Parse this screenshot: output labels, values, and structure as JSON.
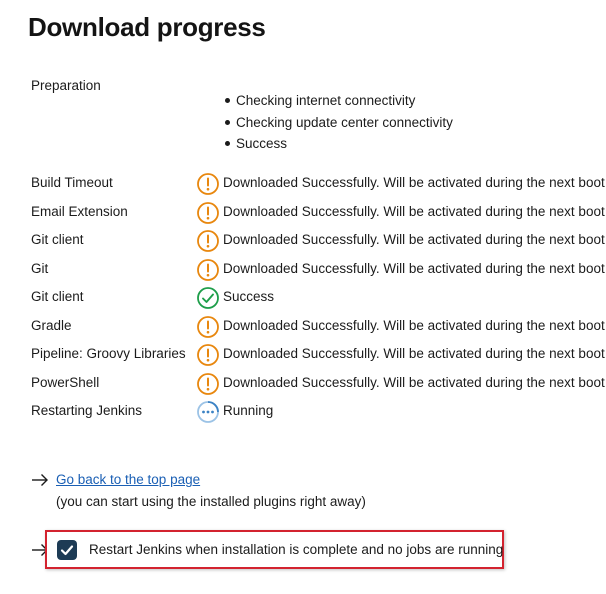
{
  "page": {
    "title": "Download progress"
  },
  "preparation": {
    "label": "Preparation",
    "steps": [
      "Checking internet connectivity",
      "Checking update center connectivity",
      "Success"
    ]
  },
  "plugins": [
    {
      "name": "Build Timeout",
      "status": "Downloaded Successfully. Will be activated during the next boot",
      "icon": "warning-icon"
    },
    {
      "name": "Email Extension",
      "status": "Downloaded Successfully. Will be activated during the next boot",
      "icon": "warning-icon"
    },
    {
      "name": "Git client",
      "status": "Downloaded Successfully. Will be activated during the next boot",
      "icon": "warning-icon"
    },
    {
      "name": "Git",
      "status": "Downloaded Successfully. Will be activated during the next boot",
      "icon": "warning-icon"
    },
    {
      "name": "Git client",
      "status": "Success",
      "icon": "success-check-icon"
    },
    {
      "name": "Gradle",
      "status": "Downloaded Successfully. Will be activated during the next boot",
      "icon": "warning-icon"
    },
    {
      "name": "Pipeline: Groovy Libraries",
      "status": "Downloaded Successfully. Will be activated during the next boot",
      "icon": "warning-icon"
    },
    {
      "name": "PowerShell",
      "status": "Downloaded Successfully. Will be activated during the next boot",
      "icon": "warning-icon"
    },
    {
      "name": "Restarting Jenkins",
      "status": "Running",
      "icon": "running-icon"
    }
  ],
  "links": {
    "back_label": "Go back to the top page",
    "back_hint": "(you can start using the installed plugins right away)"
  },
  "restart": {
    "label": "Restart Jenkins when installation is complete and no jobs are running",
    "checked": true
  },
  "colors": {
    "warning": "#e8870e",
    "success": "#1e9e4a",
    "running": "#3b82c4",
    "link": "#1a5fb4",
    "checkbox": "#1d3b55",
    "highlight_border": "#d3232f"
  }
}
